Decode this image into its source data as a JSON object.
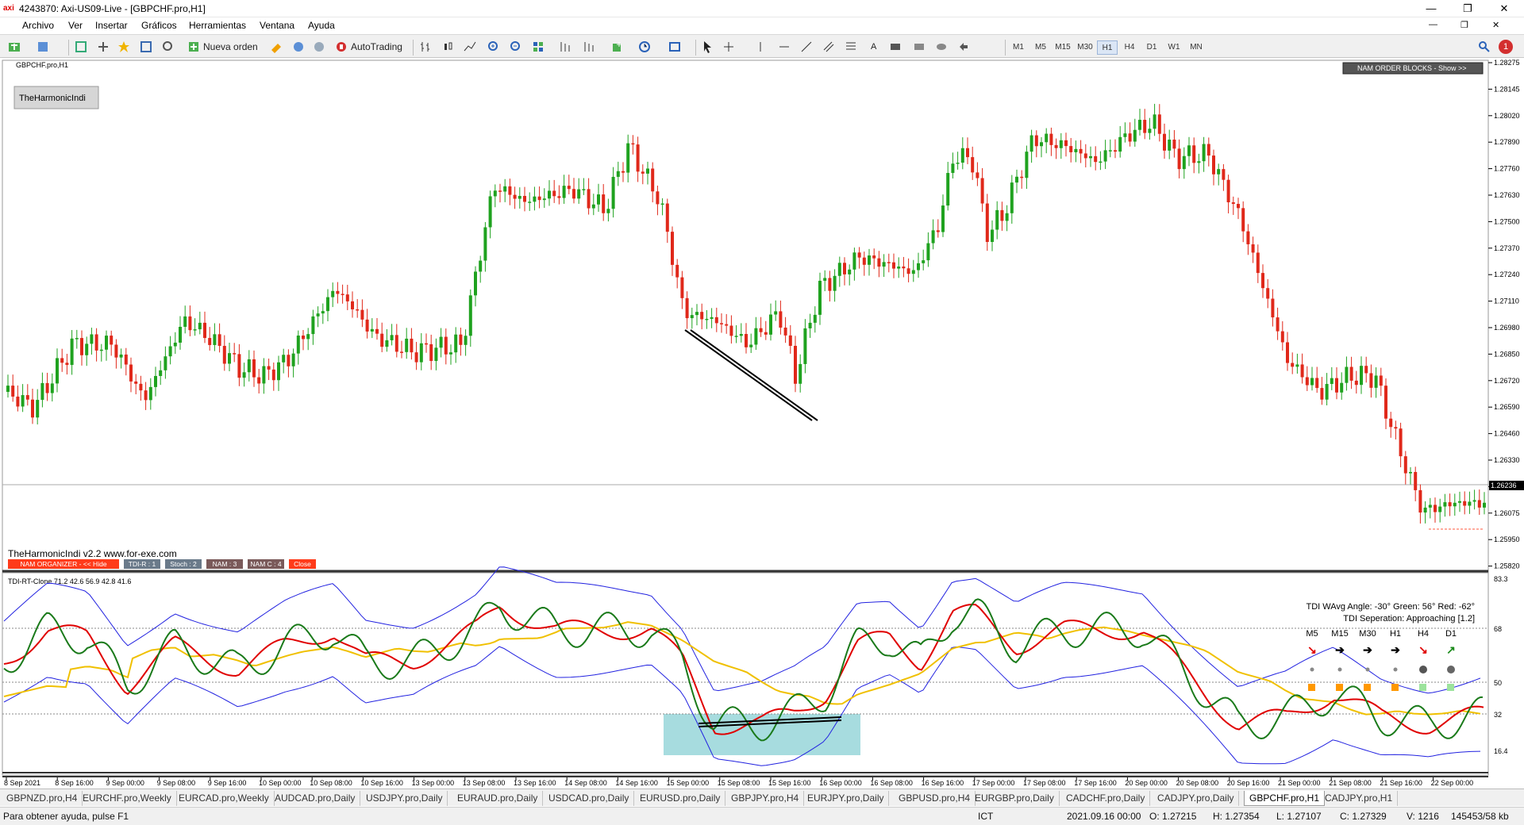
{
  "window": {
    "title": "4243870: Axi-US09-Live - [GBPCHF.pro,H1]",
    "logo": "axi"
  },
  "menu": [
    "Archivo",
    "Ver",
    "Insertar",
    "Gráficos",
    "Herramientas",
    "Ventana",
    "Ayuda"
  ],
  "toolbar": {
    "new_order": "Nueva orden",
    "autotrading": "AutoTrading",
    "timeframes": [
      "M1",
      "M5",
      "M15",
      "M30",
      "H1",
      "H4",
      "D1",
      "W1",
      "MN"
    ],
    "active_timeframe": "H1",
    "notification_count": "1"
  },
  "chart": {
    "symbol_label": "GBPCHF.pro,H1",
    "indicator_button": "TheHarmonicIndi",
    "watermark": "TheHarmonicIndi v2.2 www.for-exe.com",
    "nam_order_blocks": "NAM ORDER BLOCKS - Show >>",
    "current_price": "1.26236",
    "price_ticks": [
      "1.28275",
      "1.28145",
      "1.28020",
      "1.27890",
      "1.27760",
      "1.27630",
      "1.27500",
      "1.27370",
      "1.27240",
      "1.27110",
      "1.26980",
      "1.26850",
      "1.26720",
      "1.26590",
      "1.26460",
      "1.26330",
      "1.26205",
      "1.26075",
      "1.25950",
      "1.25820"
    ],
    "bottom_buttons": [
      {
        "label": "NAM ORGANIZER - << Hide",
        "color": "#ff3b1a"
      },
      {
        "label": "TDI-R : 1",
        "color": "#6a7a8a"
      },
      {
        "label": "Stoch : 2",
        "color": "#6a7a8a"
      },
      {
        "label": "NAM : 3",
        "color": "#7a5a5a"
      },
      {
        "label": "NAM C : 4",
        "color": "#7a5a5a"
      },
      {
        "label": "Close",
        "color": "#ff3b1a"
      }
    ]
  },
  "indicator": {
    "label": "TDI-RT-Clone 71.2 42.6 56.9 42.8 41.6",
    "info_line1": "TDI WAvg Angle: -30°  Green: 56°  Red: -62°",
    "info_line2": "TDI Seperation: Approaching [1.2]",
    "levels": [
      "83.3",
      "68",
      "50",
      "32",
      "16.4"
    ],
    "mtf": [
      {
        "tf": "M5",
        "arrow": "↘",
        "color": "#e00000",
        "dot": "#888",
        "sq": "#ff9800"
      },
      {
        "tf": "M15",
        "arrow": "➔",
        "color": "#000",
        "dot": "#888",
        "sq": "#ff9800"
      },
      {
        "tf": "M30",
        "arrow": "➔",
        "color": "#000",
        "dot": "#888",
        "sq": "#ff9800"
      },
      {
        "tf": "H1",
        "arrow": "➔",
        "color": "#000",
        "dot": "#888",
        "sq": "#ff9800"
      },
      {
        "tf": "H4",
        "arrow": "↘",
        "color": "#e00000",
        "dot": "#555",
        "sq": "#9ce39c"
      },
      {
        "tf": "D1",
        "arrow": "↗",
        "color": "#1a8a1a",
        "dot": "#666",
        "sq": "#9ce39c"
      }
    ]
  },
  "time_ticks": [
    "8 Sep 2021",
    "8 Sep 16:00",
    "9 Sep 00:00",
    "9 Sep 08:00",
    "9 Sep 16:00",
    "10 Sep 00:00",
    "10 Sep 08:00",
    "10 Sep 16:00",
    "13 Sep 00:00",
    "13 Sep 08:00",
    "13 Sep 16:00",
    "14 Sep 08:00",
    "14 Sep 16:00",
    "15 Sep 00:00",
    "15 Sep 08:00",
    "15 Sep 16:00",
    "16 Sep 00:00",
    "16 Sep 08:00",
    "16 Sep 16:00",
    "17 Sep 00:00",
    "17 Sep 08:00",
    "17 Sep 16:00",
    "20 Sep 00:00",
    "20 Sep 08:00",
    "20 Sep 16:00",
    "21 Sep 00:00",
    "21 Sep 08:00",
    "21 Sep 16:00",
    "22 Sep 00:00"
  ],
  "tabs": [
    "GBPNZD.pro,H4",
    "EURCHF.pro,Weekly",
    "EURCAD.pro,Weekly",
    "AUDCAD.pro,Daily",
    "USDJPY.pro,Daily",
    "EURAUD.pro,Daily",
    "USDCAD.pro,Daily",
    "EURUSD.pro,Daily",
    "GBPJPY.pro,H4",
    "EURJPY.pro,Daily",
    "GBPUSD.pro,H4",
    "EURGBP.pro,Daily",
    "CADCHF.pro,Daily",
    "CADJPY.pro,Daily",
    "GBPCHF.pro,H1",
    "CADJPY.pro,H1"
  ],
  "active_tab": "GBPCHF.pro,H1",
  "status": {
    "help": "Para obtener ayuda, pulse F1",
    "tz": "ICT",
    "time": "2021.09.16 00:00",
    "open": "O: 1.27215",
    "high": "H: 1.27354",
    "low": "L: 1.27107",
    "close": "C: 1.27329",
    "volume": "V: 1216",
    "traffic": "145453/58 kb"
  }
}
